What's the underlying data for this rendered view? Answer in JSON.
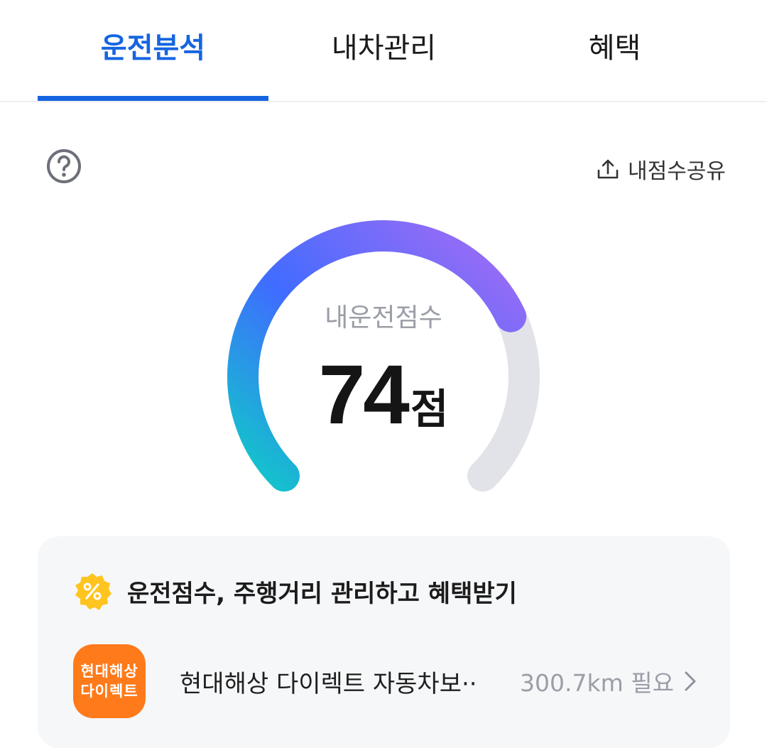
{
  "tabs": [
    {
      "label": "운전분석",
      "active": true
    },
    {
      "label": "내차관리",
      "active": false
    },
    {
      "label": "혜택",
      "active": false
    }
  ],
  "share": {
    "label": "내점수공유",
    "icon": "share-upload-icon"
  },
  "help": {
    "icon": "question-circle-icon"
  },
  "gauge": {
    "label": "내운전점수",
    "score": "74",
    "unit": "점",
    "fraction": 0.74,
    "colors": {
      "start": "#10c9c9",
      "mid": "#3f6cff",
      "end": "#a46cf5",
      "track": "#e2e3e8"
    }
  },
  "benefit_card": {
    "icon": "percent-badge-icon",
    "title": "운전점수, 주행거리 관리하고 혜택받기",
    "items": [
      {
        "logo_lines": [
          "현대해상",
          "다이렉트"
        ],
        "name": "현대해상 다이렉트 자동차보··",
        "meta": "300.7km 필요",
        "icon": "chevron-right-icon"
      }
    ]
  },
  "colors": {
    "accent": "#1565e0",
    "logo_bg": "#ff7a1a",
    "badge": "#ffc41f"
  }
}
